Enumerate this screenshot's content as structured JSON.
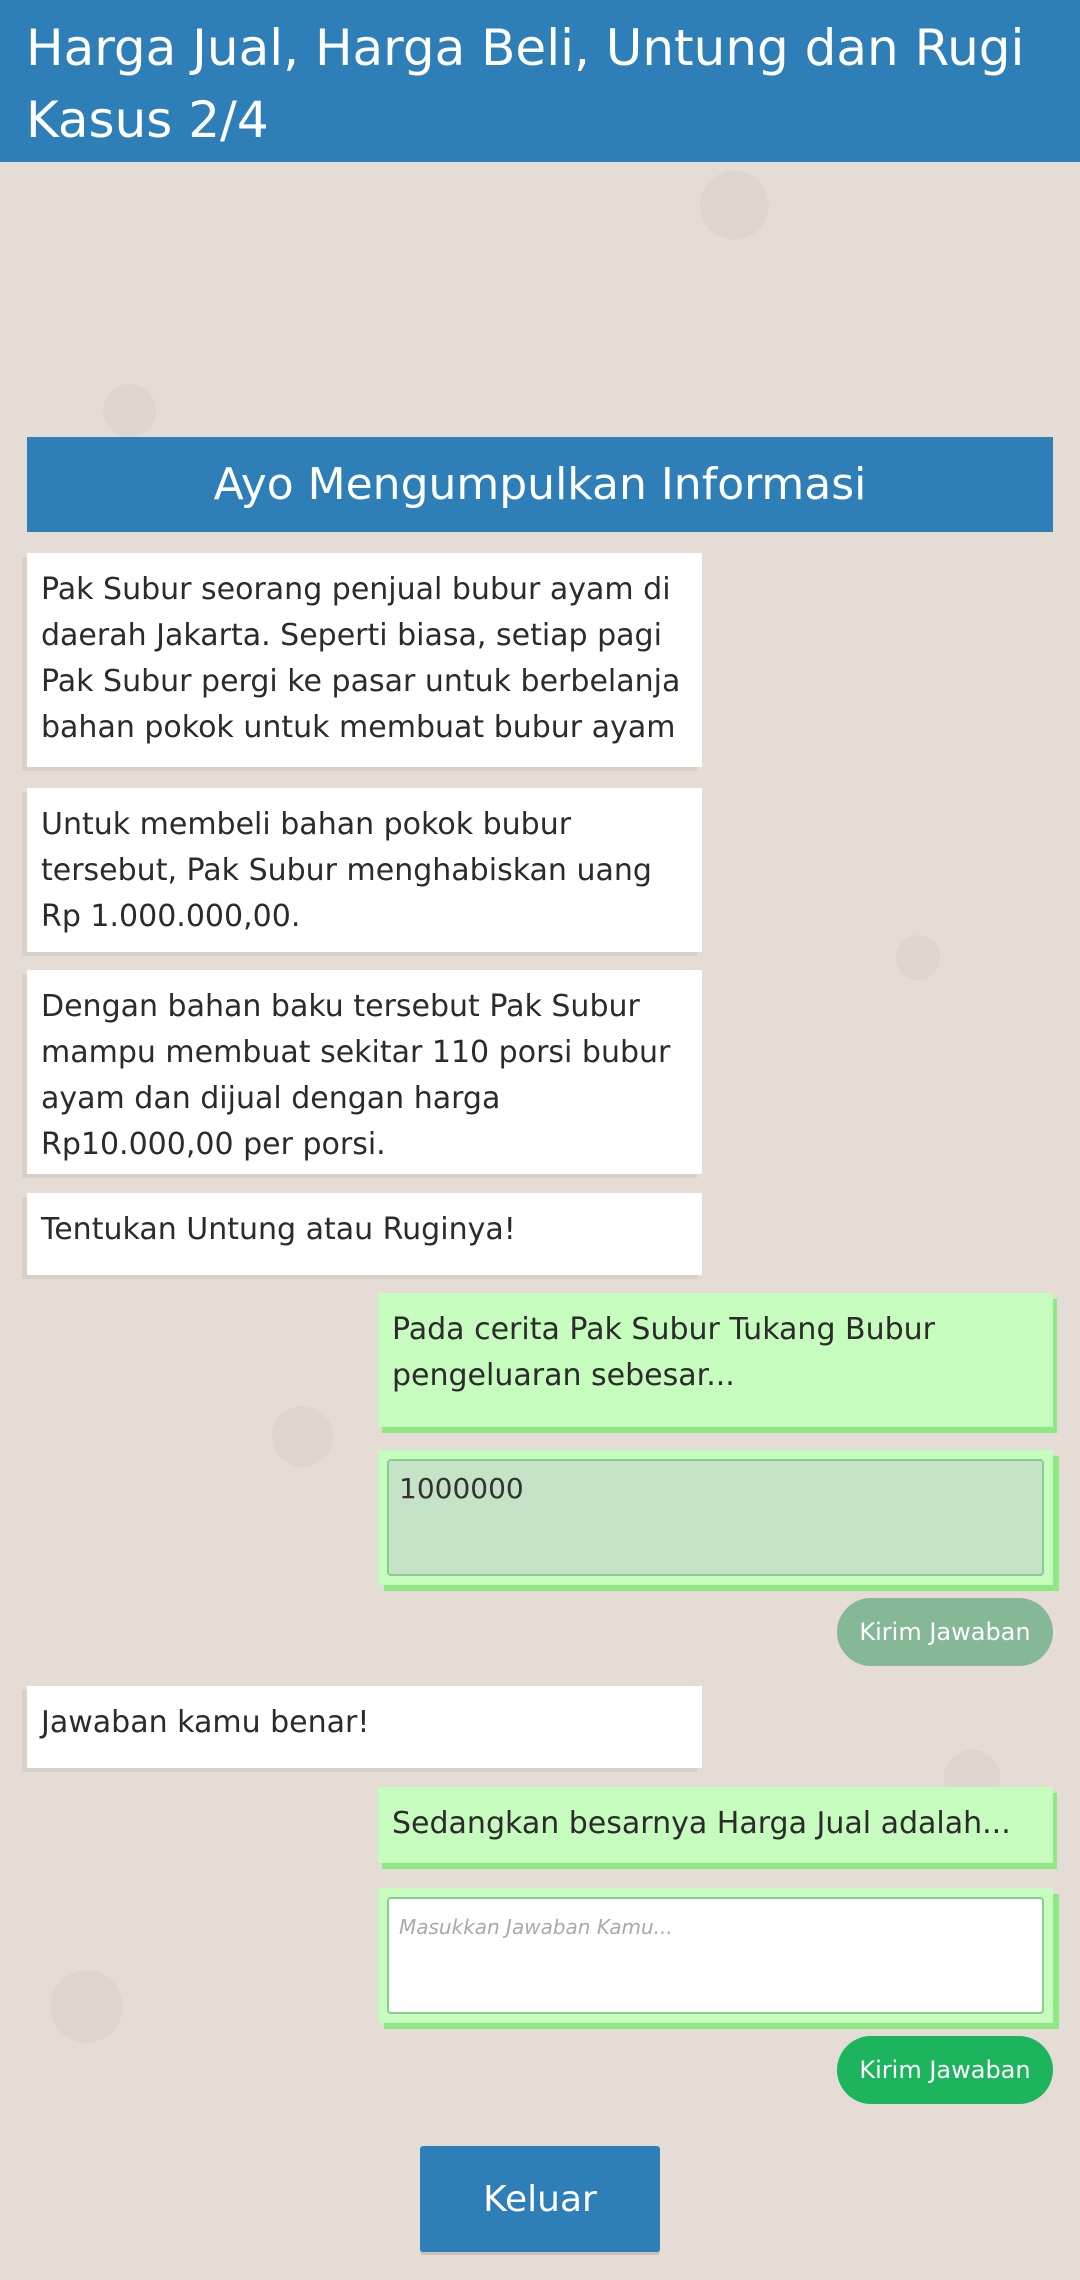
{
  "header": {
    "title": "Harga Jual, Harga Beli, Untung dan Rugi",
    "subtitle": "Kasus 2/4"
  },
  "section_title": "Ayo Mengumpulkan Informasi",
  "messages": [
    "Pak Subur seorang penjual bubur ayam di daerah Jakarta. Seperti biasa, setiap pagi Pak Subur pergi ke pasar untuk berbelanja bahan pokok untuk membuat bubur ayam",
    "Untuk membeli bahan pokok bubur tersebut, Pak Subur menghabiskan uang Rp 1.000.000,00.",
    "Dengan bahan baku tersebut Pak Subur mampu membuat sekitar 110 porsi bubur ayam dan dijual dengan harga Rp10.000,00 per porsi.",
    "Tentukan Untung atau Ruginya!"
  ],
  "question1": {
    "text": "Pada cerita Pak Subur Tukang Bubur pengeluaran sebesar...",
    "answer_value": "1000000",
    "send_label": "Kirim Jawaban"
  },
  "feedback": "Jawaban kamu benar!",
  "question2": {
    "text": "Sedangkan besarnya Harga Jual adalah...",
    "answer_value": "",
    "placeholder": "Masukkan Jawaban Kamu...",
    "send_label": "Kirim Jawaban"
  },
  "exit_label": "Keluar",
  "colors": {
    "header": "#2e7fb8",
    "question_bubble": "#c7fcbf",
    "send_active": "#1db45e",
    "send_disabled": "#84b897"
  }
}
